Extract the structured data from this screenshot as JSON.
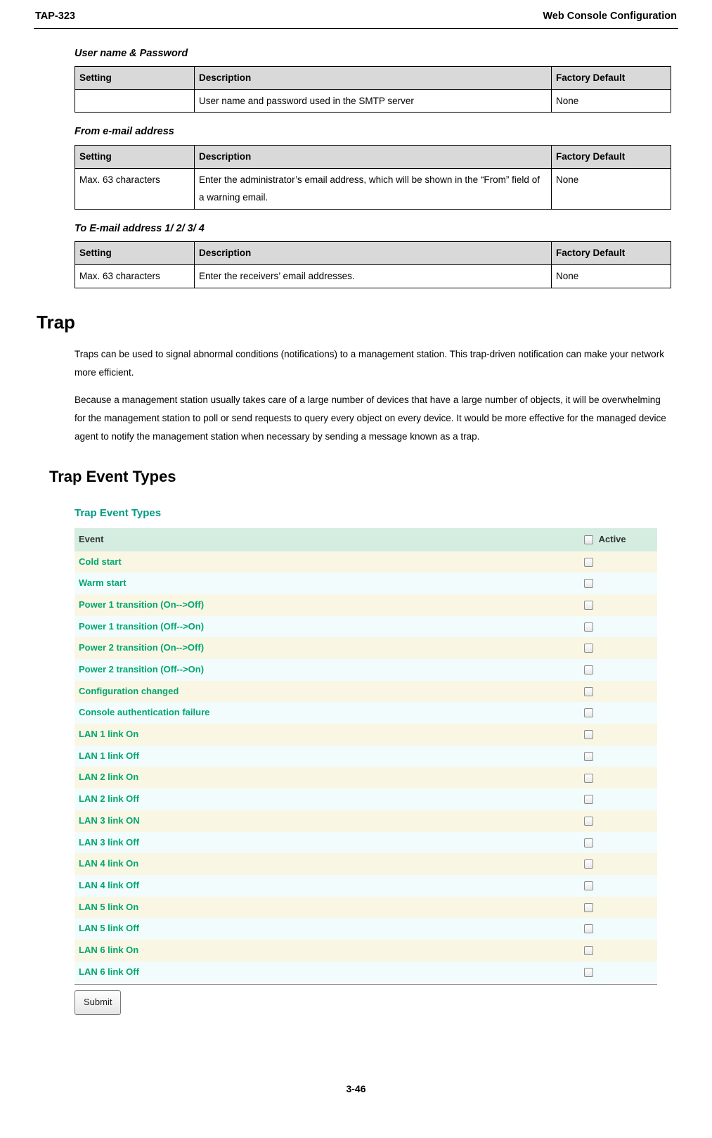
{
  "header": {
    "left": "TAP-323",
    "right": "Web Console Configuration"
  },
  "tables": [
    {
      "title": "User name & Password",
      "cols": {
        "setting": "Setting",
        "description": "Description",
        "factory": "Factory Default"
      },
      "rows": [
        {
          "setting": "",
          "description": "User name and password used in the SMTP server",
          "factory": "None"
        }
      ]
    },
    {
      "title": "From e-mail address",
      "cols": {
        "setting": "Setting",
        "description": "Description",
        "factory": "Factory Default"
      },
      "rows": [
        {
          "setting": "Max. 63 characters",
          "description": "Enter the administrator’s email address, which will be shown in the “From” field of a warning email.",
          "factory": "None"
        }
      ]
    },
    {
      "title": "To E-mail address 1/ 2/ 3/ 4",
      "cols": {
        "setting": "Setting",
        "description": "Description",
        "factory": "Factory Default"
      },
      "rows": [
        {
          "setting": "Max. 63 characters",
          "description": "Enter the receivers’ email addresses.",
          "factory": "None"
        }
      ]
    }
  ],
  "trap_heading": "Trap",
  "trap_paras": [
    "Traps can be used to signal abnormal conditions (notifications) to a management station. This trap-driven notification can make your network more efficient.",
    "Because a management station usually takes care of a large number of devices that have a large number of objects, it will be overwhelming for the management station to poll or send requests to query every object on every device. It would be more effective for the managed device agent to notify the management station when necessary by sending a message known as a trap."
  ],
  "trap_event_heading": "Trap Event Types",
  "screenshot": {
    "title": "Trap Event Types",
    "col_event": "Event",
    "col_active": "Active",
    "events": [
      "Cold start",
      "Warm start",
      "Power 1 transition (On-->Off)",
      "Power 1 transition (Off-->On)",
      "Power 2 transition (On-->Off)",
      "Power 2 transition (Off-->On)",
      "Configuration changed",
      "Console authentication failure",
      "LAN 1 link On",
      "LAN 1 link Off",
      "LAN 2 link On",
      "LAN 2 link Off",
      "LAN 3 link ON",
      "LAN 3 link Off",
      "LAN 4 link On",
      "LAN 4 link Off",
      "LAN 5 link On",
      "LAN 5 link Off",
      "LAN 6 link On",
      "LAN 6 link Off"
    ],
    "submit": "Submit"
  },
  "page_number": "3-46"
}
